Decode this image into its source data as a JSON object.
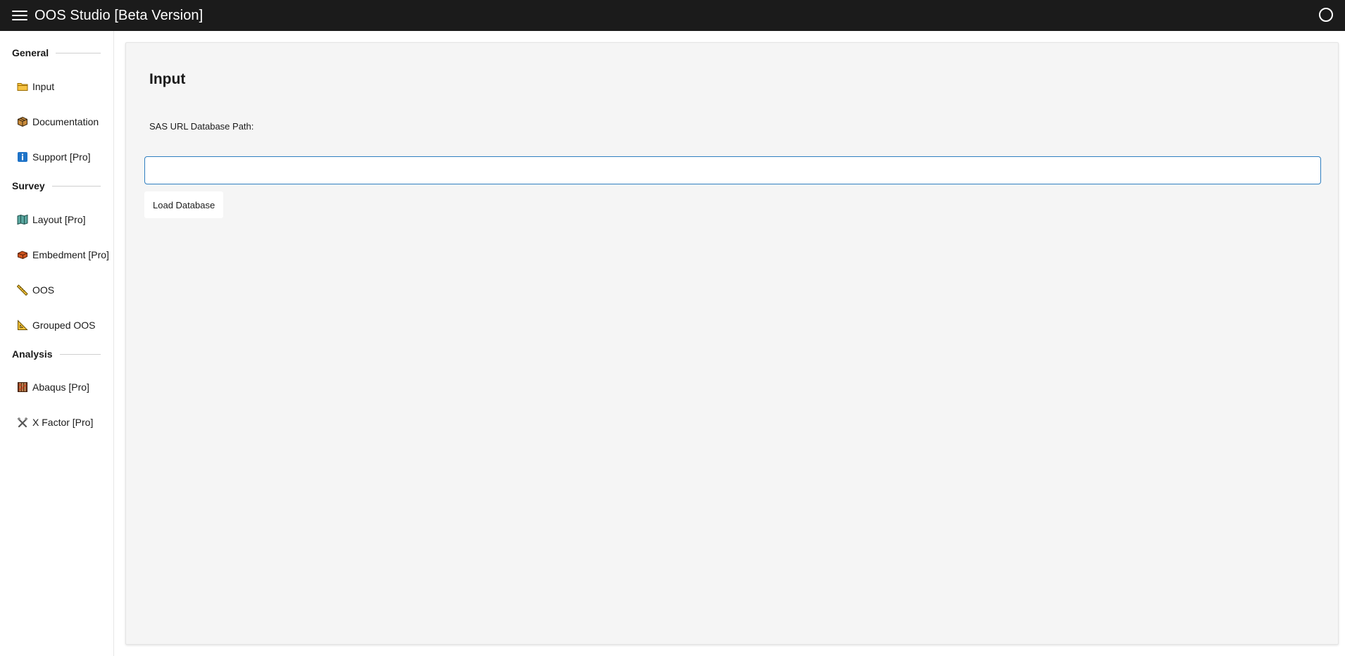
{
  "app": {
    "title": "OOS Studio [Beta Version]"
  },
  "sidebar": {
    "sections": [
      {
        "label": "General",
        "items": [
          {
            "label": "Input",
            "icon": "folder-icon"
          },
          {
            "label": "Documentation",
            "icon": "package-icon"
          },
          {
            "label": "Support [Pro]",
            "icon": "info-icon"
          }
        ]
      },
      {
        "label": "Survey",
        "items": [
          {
            "label": "Layout [Pro]",
            "icon": "map-icon"
          },
          {
            "label": "Embedment [Pro]",
            "icon": "brick-icon"
          },
          {
            "label": "OOS",
            "icon": "ruler-icon"
          },
          {
            "label": "Grouped OOS",
            "icon": "triangle-ruler-icon"
          }
        ]
      },
      {
        "label": "Analysis",
        "items": [
          {
            "label": "Abaqus [Pro]",
            "icon": "abacus-icon"
          },
          {
            "label": "X Factor [Pro]",
            "icon": "tools-icon"
          }
        ]
      }
    ]
  },
  "main": {
    "title": "Input",
    "field_label": "SAS URL Database Path:",
    "input_value": "",
    "input_placeholder": "",
    "load_button_label": "Load Database"
  },
  "colors": {
    "topbar": "#1b1b1b",
    "panel": "#f5f5f5",
    "input_focus_border": "#2f7fc0"
  }
}
